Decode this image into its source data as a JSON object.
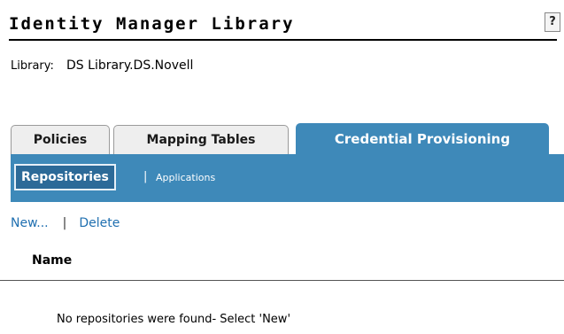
{
  "header": {
    "title": "Identity Manager Library",
    "help_label": "?"
  },
  "library": {
    "label": "Library:",
    "value": "DS Library.DS.Novell"
  },
  "tabs": [
    {
      "label": "Policies",
      "active": false
    },
    {
      "label": "Mapping Tables",
      "active": false
    },
    {
      "label": "Credential Provisioning",
      "active": true
    }
  ],
  "subnav": {
    "repositories_label": "Repositories",
    "separator": "|",
    "applications_label": "Applications"
  },
  "actions": {
    "new_label": "New...",
    "separator": "|",
    "delete_label": "Delete"
  },
  "table": {
    "columns": [
      "Name"
    ],
    "empty_message": "No repositories were found- Select 'New'"
  },
  "colors": {
    "accent": "#3e89b9",
    "subtab_active": "#2c6a98",
    "link": "#1f6fb0",
    "tab_inactive_bg": "#eeeeee"
  }
}
